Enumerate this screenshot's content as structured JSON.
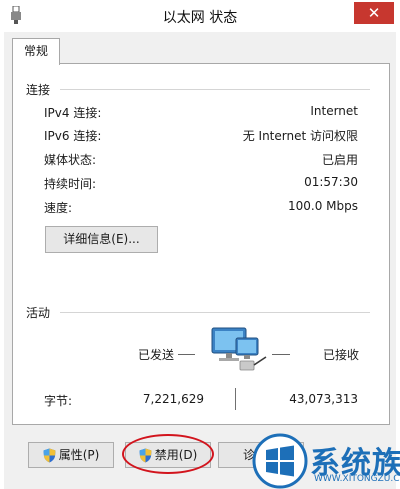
{
  "window": {
    "title": "以太网 状态",
    "close_glyph": "✕"
  },
  "tabs": [
    {
      "label": "常规"
    }
  ],
  "connection": {
    "heading": "连接",
    "rows": [
      {
        "label": "IPv4 连接:",
        "value": "Internet"
      },
      {
        "label": "IPv6 连接:",
        "value": "无 Internet 访问权限"
      },
      {
        "label": "媒体状态:",
        "value": "已启用"
      },
      {
        "label": "持续时间:",
        "value": "01:57:30"
      },
      {
        "label": "速度:",
        "value": "100.0 Mbps"
      }
    ],
    "details_button": "详细信息(E)..."
  },
  "activity": {
    "heading": "活动",
    "sent_label": "已发送",
    "received_label": "已接收",
    "bytes_label": "字节:",
    "bytes_sent": "7,221,629",
    "bytes_received": "43,073,313"
  },
  "buttons": {
    "properties": "属性(P)",
    "disable": "禁用(D)",
    "diagnose": "诊断"
  },
  "watermark": {
    "brand": "系统族",
    "url": "WWW.XITONGZU.COM"
  },
  "colors": {
    "highlight_ring": "#d2141d",
    "close_button": "#c7372f",
    "watermark_blue": "#1d6fb8"
  }
}
